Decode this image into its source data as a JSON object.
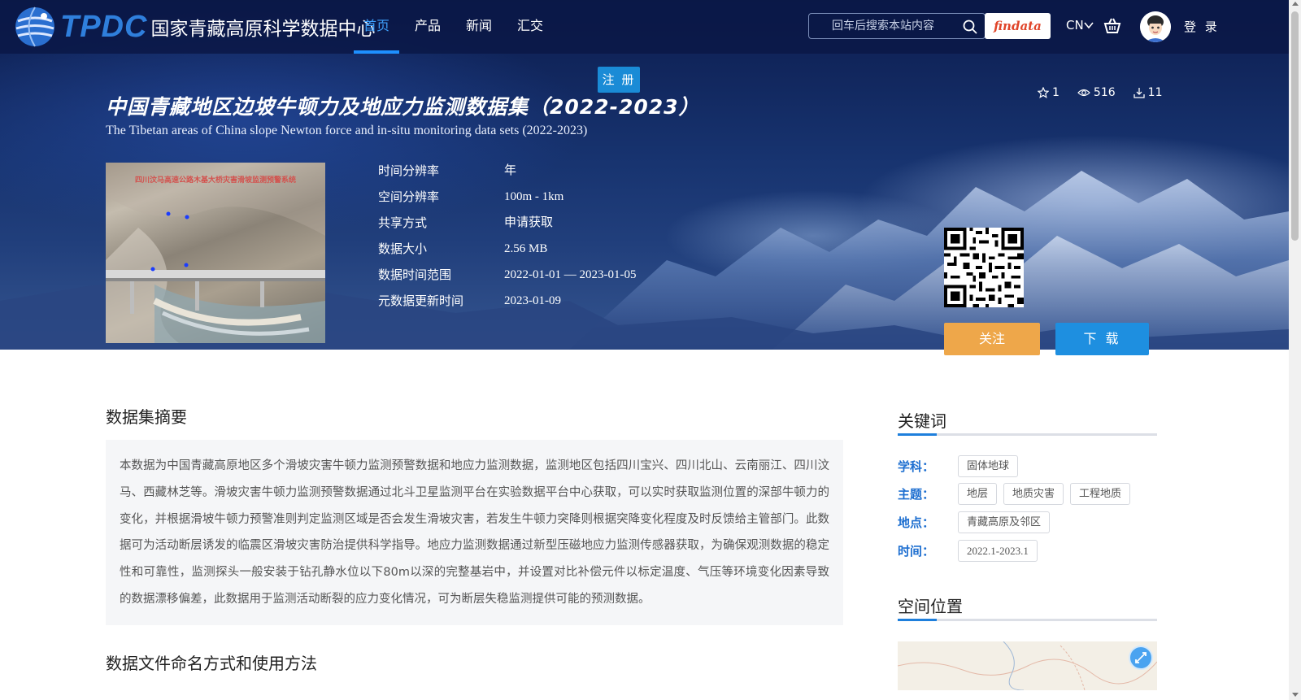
{
  "header": {
    "logo_text": "TPDC",
    "site_name": "国家青藏高原科学数据中心",
    "nav": [
      {
        "label": "首页",
        "active": true
      },
      {
        "label": "产品",
        "active": false
      },
      {
        "label": "新闻",
        "active": false
      },
      {
        "label": "汇交",
        "active": false
      }
    ],
    "search_placeholder": "回车后搜索本站内容",
    "findata_label": "findata",
    "lang": "CN",
    "login_label": "登 录",
    "register_label": "注 册"
  },
  "dataset": {
    "title_cn": "中国青藏地区边坡牛顿力及地应力监测数据集（2022-2023）",
    "title_en": "The Tibetan areas of China slope Newton force and in-situ monitoring data sets (2022-2023)",
    "stats": {
      "favorites": "1",
      "views": "516",
      "downloads": "11"
    },
    "thumbnail_caption": "四川汶马高速公路木基大桥灾害滑坡监测预警系统",
    "metadata": [
      {
        "label": "时间分辨率",
        "value": "年"
      },
      {
        "label": "空间分辨率",
        "value": "100m - 1km"
      },
      {
        "label": "共享方式",
        "value": "申请获取"
      },
      {
        "label": "数据大小",
        "value": "2.56 MB"
      },
      {
        "label": "数据时间范围",
        "value": "2022-01-01 — 2023-01-05"
      },
      {
        "label": "元数据更新时间",
        "value": "2023-01-09"
      }
    ],
    "follow_label": "关注",
    "download_label": "下 载"
  },
  "main": {
    "abstract_title": "数据集摘要",
    "abstract_text": "本数据为中国青藏高原地区多个滑坡灾害牛顿力监测预警数据和地应力监测数据，监测地区包括四川宝兴、四川北山、云南丽江、四川汶马、西藏林芝等。滑坡灾害牛顿力监测预警数据通过北斗卫星监测平台在实验数据平台中心获取，可以实时获取监测位置的深部牛顿力的变化，并根据滑坡牛顿力预警准则判定监测区域是否会发生滑坡灾害，若发生牛顿力突降则根据突降变化程度及时反馈给主管部门。此数据可为活动断层诱发的临震区滑坡灾害防治提供科学指导。地应力监测数据通过新型压磁地应力监测传感器获取，为确保观测数据的稳定性和可靠性，监测探头一般安装于钻孔静水位以下80m以深的完整基岩中，并设置对比补偿元件以标定温度、气压等环境变化因素导致的数据漂移偏差，此数据用于监测活动断裂的应力变化情况，可为断层失稳监测提供可能的预测数据。",
    "naming_title": "数据文件命名方式和使用方法"
  },
  "sidebar": {
    "keywords_title": "关键词",
    "keywords": [
      {
        "label": "学科：",
        "tags": [
          "固体地球"
        ]
      },
      {
        "label": "主题：",
        "tags": [
          "地层",
          "地质灾害",
          "工程地质"
        ]
      },
      {
        "label": "地点：",
        "tags": [
          "青藏高原及邻区"
        ]
      },
      {
        "label": "时间：",
        "tags": [
          "2022.1-2023.1"
        ]
      }
    ],
    "location_title": "空间位置"
  },
  "colors": {
    "accent_blue": "#1e8fe0",
    "follow_orange": "#eea74a",
    "keyword_label_blue": "#1e6fd0"
  }
}
